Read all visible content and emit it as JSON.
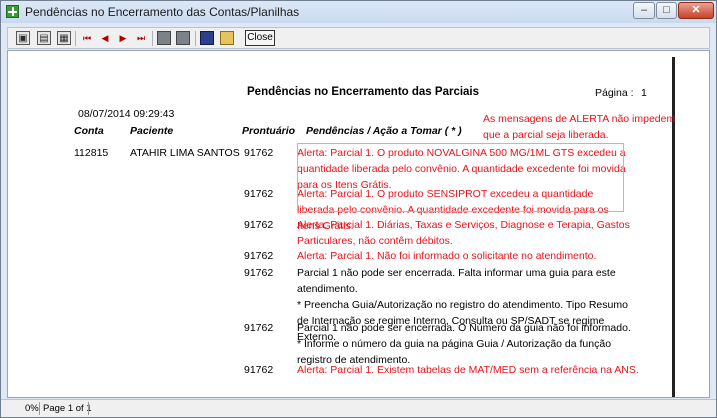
{
  "window": {
    "title": "Pendências no Encerramento das Contas/Planilhas"
  },
  "toolbar": {
    "close_label": "Close"
  },
  "report": {
    "title": "Pendências no Encerramento das Parciais",
    "page_label": "Página :",
    "page_number": "1",
    "datetime": "08/07/2014 09:29:43",
    "annotation": "As mensagens de ALERTA não impedem que a parcial seja liberada.",
    "columns": {
      "conta": "Conta",
      "paciente": "Paciente",
      "prontuario": "Prontuário",
      "pendencias": "Pendências / Ação a Tomar ( * )"
    },
    "conta": "112815",
    "paciente": "ATAHIR LIMA SANTOS",
    "rows": [
      {
        "prontuario": "91762",
        "text": "Alerta: Parcial 1. O produto NOVALGINA 500 MG/1ML GTS excedeu a quantidade liberada pelo convênio. A quantidade excedente foi movida para os Itens Grátis."
      },
      {
        "prontuario": "91762",
        "text": "Alerta: Parcial 1. O produto SENSIPROT excedeu a quantidade liberada pelo convênio. A quantidade excedente foi movida para os Itens Grátis."
      },
      {
        "prontuario": "91762",
        "text": "Alerta: Parcial 1. Diárias, Taxas e Serviços, Diagnose e Terapia, Gastos Particulares, não contêm débitos."
      },
      {
        "prontuario": "91762",
        "text": "Alerta: Parcial 1. Não foi informado o solicitante no atendimento."
      },
      {
        "prontuario": "91762",
        "text": "Parcial 1 não pode ser encerrada. Falta informar uma guia para este atendimento.",
        "detail": " * Preencha Guia/Autorização no registro do atendimento. Tipo Resumo de Internação se regime Interno, Consulta ou SP/SADT se regime Externo."
      },
      {
        "prontuario": "91762",
        "text": "Parcial 1 não pode ser encerrada. O Número da guia não foi informado.",
        "detail": " * Informe o número da guia na página Guia / Autorização da função registro de atendimento."
      },
      {
        "prontuario": "91762",
        "text": "Alerta: Parcial 1. Existem tabelas de MAT/MED sem a referência na ANS."
      }
    ]
  },
  "status": {
    "zoom": "0%",
    "page": "Page 1 of 1"
  },
  "colors": {
    "alert": "#e8121b",
    "highlight_border": "#f0b634",
    "titlebar": "#c9daf0"
  },
  "icons": [
    "app-icon",
    "minimize-icon",
    "maximize-icon",
    "window-close-icon",
    "one-page-icon",
    "page-width-icon",
    "zoom-icon",
    "first-page-icon",
    "previous-page-icon",
    "next-page-icon",
    "last-page-icon",
    "print-setup-icon",
    "print-icon",
    "save-icon",
    "open-icon"
  ]
}
